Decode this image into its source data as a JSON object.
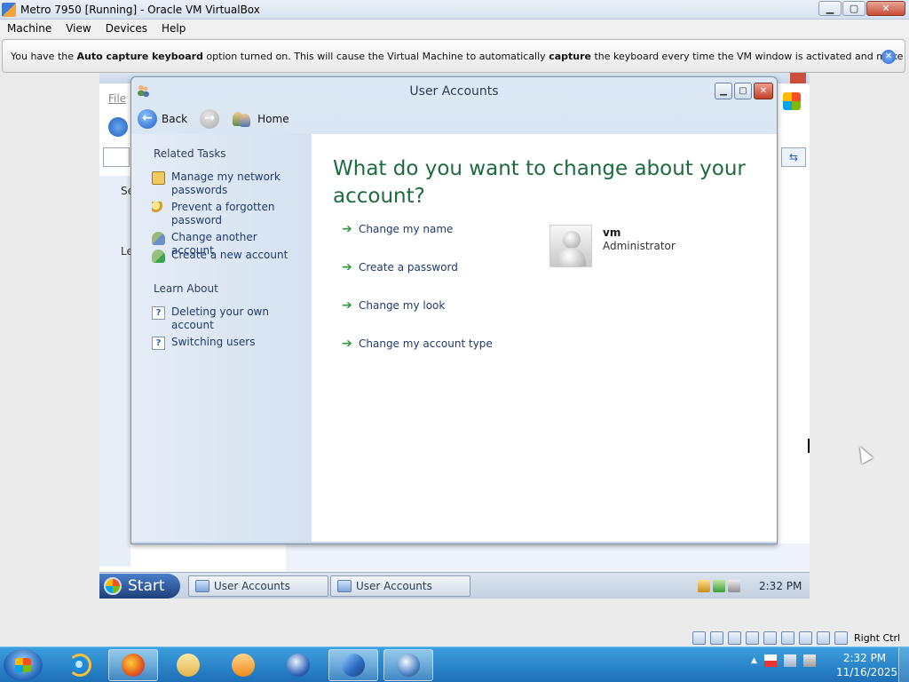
{
  "host_window": {
    "title": "Metro 7950 [Running] - Oracle VM VirtualBox",
    "controls": {
      "minimize": "▁",
      "maximize": "▢",
      "close": "✕"
    },
    "menu": [
      "Machine",
      "View",
      "Devices",
      "Help"
    ]
  },
  "notice": {
    "part1": "You have the ",
    "bold1": "Auto capture keyboard",
    "part2": " option turned on. This will cause the Virtual Machine to automatically ",
    "bold2": "capture",
    "part3": " the keyboard every time the VM window is activated and make it unavailable to",
    "close_glyph": "✕"
  },
  "background_window": {
    "menu_file": "File",
    "left_label_1": "Se",
    "left_label_2": "Le",
    "refresh_glyph": "⇆"
  },
  "user_accounts": {
    "title": "User Accounts",
    "controls": {
      "minimize": "▁",
      "maximize": "▢",
      "close": "✕"
    },
    "nav": {
      "back_glyph": "←",
      "back_label": "Back",
      "forward_glyph": "→",
      "home_label": "Home"
    },
    "related_tasks_title": "Related Tasks",
    "related_tasks": [
      {
        "icon": "network-passwords-icon",
        "label": "Manage my network passwords"
      },
      {
        "icon": "key-icon",
        "label": "Prevent a forgotten password"
      },
      {
        "icon": "users-icon",
        "label": "Change another account"
      },
      {
        "icon": "new-user-icon",
        "label": "Create a new account"
      }
    ],
    "learn_about_title": "Learn About",
    "learn_about": [
      {
        "icon": "help-icon",
        "label": "Deleting your own account"
      },
      {
        "icon": "help-icon",
        "label": "Switching users"
      }
    ],
    "help_glyph": "?",
    "heading": "What do you want to change about your account?",
    "options": [
      {
        "label": "Change my name"
      },
      {
        "label": "Create a password"
      },
      {
        "label": "Change my look"
      },
      {
        "label": "Change my account type"
      }
    ],
    "arrow_glyph": "➔",
    "account": {
      "name": "vm",
      "role": "Administrator"
    }
  },
  "guest_taskbar": {
    "start_label": "Start",
    "tasks": [
      "User Accounts",
      "User Accounts"
    ],
    "clock": "2:32 PM"
  },
  "vm_status": {
    "host_key_label": "Right Ctrl"
  },
  "host_taskbar": {
    "tray_up": "▲",
    "clock_time": "2:32 PM",
    "clock_date": "11/16/2025"
  },
  "colors": {
    "heading_green": "#1d6b3e",
    "link_blue": "#1f3b6d",
    "arrow_green": "#2e9a3b",
    "host_taskbar_blue": "#1e6fb7"
  }
}
